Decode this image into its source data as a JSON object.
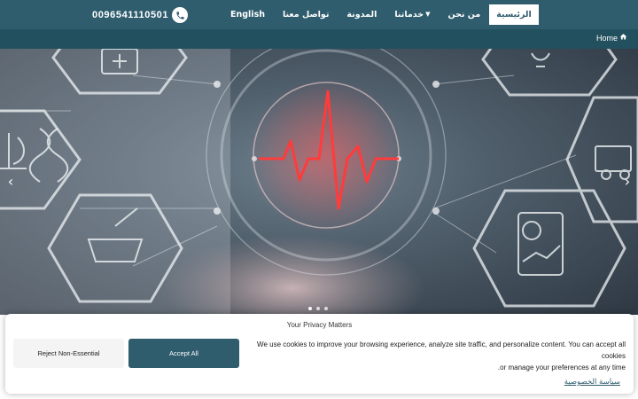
{
  "header": {
    "phone": "0096541110501",
    "phone_icon": "phone-icon",
    "nav": [
      {
        "label": "English"
      },
      {
        "label": "تواصل معنا"
      },
      {
        "label": "المدونة"
      },
      {
        "label": "خدماتنا",
        "has_dropdown": true
      },
      {
        "label": "من نحن"
      },
      {
        "label": "الرئيسية",
        "active": true
      }
    ]
  },
  "breadcrumb": {
    "home_label": "Home",
    "icon": "home-icon"
  },
  "hero": {
    "prev_icon": "chevron-left-icon",
    "next_icon": "chevron-right-icon",
    "slide_count": 3,
    "active_slide": 1
  },
  "cookie_banner": {
    "title": "Your Privacy Matters",
    "reject_label": "Reject Non-Essential",
    "accept_label": "Accept All",
    "message_line1": "We use cookies to improve your browsing experience, analyze site traffic, and personalize content. You can accept all cookies",
    "message_line2": "or manage your preferences at any time.",
    "policy_link": "سياسة الخصوصية"
  },
  "colors": {
    "brand": "#2f5d6e",
    "brand_dark": "#23505f",
    "ecg": "#ff3b3b"
  }
}
